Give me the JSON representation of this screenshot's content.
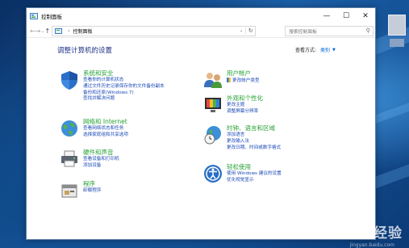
{
  "window": {
    "title": "控制面板",
    "controls": {
      "minimize": "—",
      "maximize": "☐",
      "close": "✕"
    }
  },
  "nav": {
    "back": "←",
    "forward": "→",
    "recent": "⌄",
    "up": "↑",
    "address_path": "控制面板",
    "address_sep": "›",
    "search_placeholder": "搜索控制面板"
  },
  "page": {
    "heading": "调整计算机的设置",
    "viewby_label": "查看方式:",
    "viewby_value": "类别",
    "viewby_arrow": "▼"
  },
  "categories_left": [
    {
      "title": "系统和安全",
      "icon": "shield-icon",
      "links": [
        "查看你的计算机状态",
        "通过文件历史记录保存你的文件备份副本",
        "备份和还原(Windows 7)",
        "查找并解决问题"
      ]
    },
    {
      "title": "网络和 Internet",
      "icon": "network-globe-icon",
      "links": [
        "查看网络状态和任务",
        "选择家庭组和共享选项"
      ]
    },
    {
      "title": "硬件和声音",
      "icon": "printer-icon",
      "links": [
        "查看设备和打印机",
        "添加设备"
      ]
    },
    {
      "title": "程序",
      "icon": "programs-icon",
      "links": [
        "卸载程序"
      ]
    }
  ],
  "categories_right": [
    {
      "title": "用户帐户",
      "icon": "users-icon",
      "links": [
        "更改帐户类型"
      ]
    },
    {
      "title": "外观和个性化",
      "icon": "appearance-icon",
      "links": [
        "更改主题",
        "调整屏幕分辨率"
      ]
    },
    {
      "title": "时钟、语言和区域",
      "icon": "clock-globe-icon",
      "links": [
        "添加语言",
        "更改输入法",
        "更改日期、时间或数字格式"
      ]
    },
    {
      "title": "轻松使用",
      "icon": "ease-of-access-icon",
      "links": [
        "使用 Windows 建议的设置",
        "优化视觉显示"
      ]
    }
  ],
  "watermark": {
    "text": "Bai度 经验",
    "sub": "jingyan.baidu.com"
  },
  "colors": {
    "category_title": "#26a234",
    "link": "#1a49b8",
    "heading": "#1e3287"
  }
}
